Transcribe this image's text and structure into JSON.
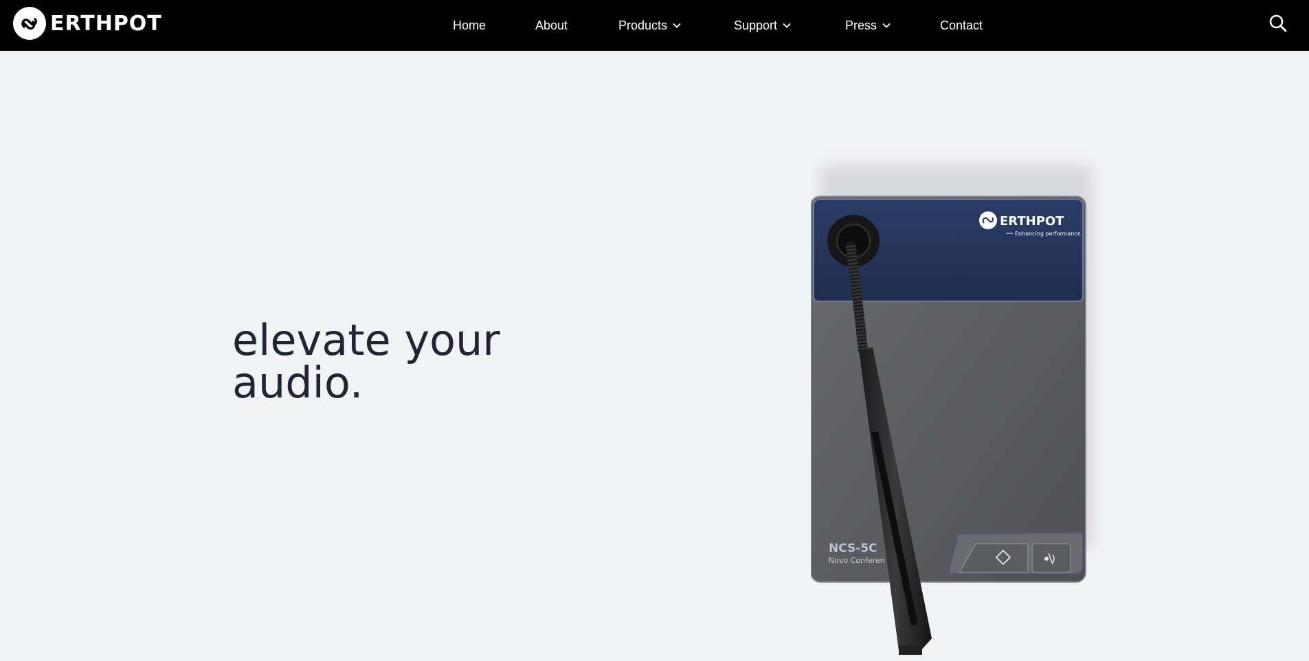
{
  "brand": {
    "name": "ERTHPOT"
  },
  "nav": {
    "items": [
      {
        "label": "Home",
        "has_dropdown": false
      },
      {
        "label": "About",
        "has_dropdown": false
      },
      {
        "label": "Products",
        "has_dropdown": true
      },
      {
        "label": "Support",
        "has_dropdown": true
      },
      {
        "label": "Press",
        "has_dropdown": true
      },
      {
        "label": "Contact",
        "has_dropdown": false
      }
    ],
    "search_icon": "search-icon"
  },
  "hero": {
    "headline_line1": "elevate your",
    "headline_line2": "audio."
  },
  "product": {
    "brand": "ERTHPOT",
    "tagline": "Enhancing performance",
    "model": "NCS-5C",
    "subtitle": "Novo Conferen"
  },
  "colors": {
    "navbar": "#000000",
    "background": "#f2f3f5",
    "headline": "#1e2533",
    "device_top_panel": "#26365c",
    "device_body": "#5b5c5f"
  }
}
